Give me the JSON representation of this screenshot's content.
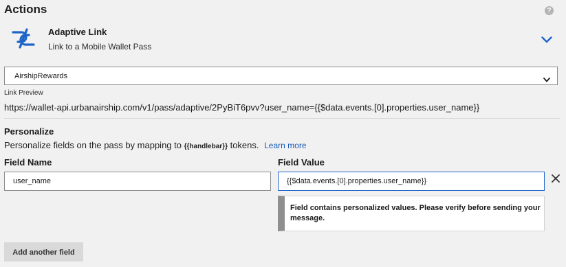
{
  "header": {
    "title": "Actions",
    "help_icon": "question-circle-icon",
    "help_glyph": "?"
  },
  "action": {
    "icon": "adaptive-link-icon",
    "title": "Adaptive Link",
    "subtitle": "Link to a Mobile Wallet Pass",
    "accent_color": "#1e64c8"
  },
  "pass_select": {
    "value": "AirshipRewards"
  },
  "link_preview": {
    "label": "Link Preview",
    "url": "https://wallet-api.urbanairship.com/v1/pass/adaptive/2PyBiT6pvv?user_name={{$data.events.[0].properties.user_name}}"
  },
  "personalize": {
    "title": "Personalize",
    "desc_before": "Personalize fields on the pass by mapping to ",
    "desc_token": "{{handlebar}}",
    "desc_after": " tokens.",
    "learn_more": "Learn more",
    "field_name_label": "Field Name",
    "field_value_label": "Field Value",
    "field_name_value": "user_name",
    "field_value_value": "{{$data.events.[0].properties.user_name}}",
    "remove_icon": "close-icon",
    "alert_text": "Field contains personalized values. Please verify before sending your message.",
    "add_button": "Add another field"
  },
  "colors": {
    "background": "#f1f1f1",
    "link": "#1a5db8",
    "focus_border": "#1e64c8",
    "alert_bar": "#8f8f8f"
  }
}
